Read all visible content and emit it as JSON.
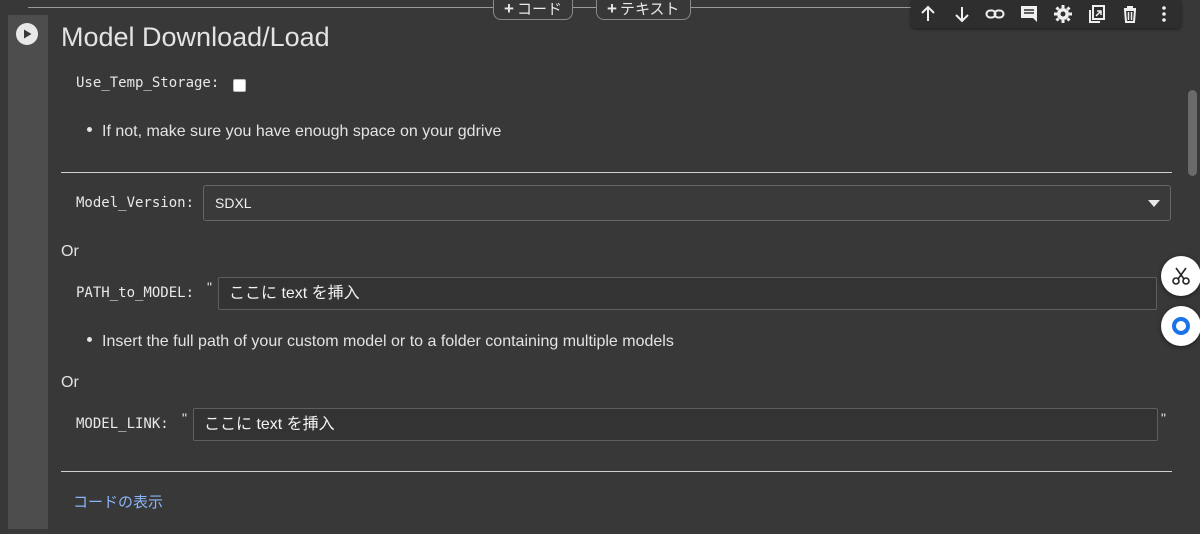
{
  "toolbar": {
    "add_code_label": "コード",
    "add_text_label": "テキスト",
    "icons": [
      "arrow-up-icon",
      "arrow-down-icon",
      "link-icon",
      "comment-icon",
      "gear-icon",
      "mirror-cell-icon",
      "trash-icon",
      "more-vert-icon"
    ]
  },
  "cell": {
    "title": "Model Download/Load",
    "use_temp_storage": {
      "label": "Use_Temp_Storage:",
      "checked": false
    },
    "temp_note": "If not, make sure you have enough space on your gdrive",
    "model_version": {
      "label": "Model_Version:",
      "value": "SDXL"
    },
    "or_1": "Or",
    "path_to_model": {
      "label": "PATH_to_MODEL:",
      "quote": "\"",
      "value": "ここに text を挿入"
    },
    "path_note": "Insert the full path of your custom model or to a folder containing multiple models",
    "or_2": "Or",
    "model_link": {
      "label": "MODEL_LINK:",
      "quote_open": "\"",
      "value": "ここに text を挿入",
      "quote_close": "\""
    },
    "show_code": "コードの表示"
  },
  "colors": {
    "background": "#383838",
    "gutter": "#4d4d4d",
    "link": "#8ab4f8",
    "text": "#e3e3e3"
  },
  "floating": [
    "scissors-icon",
    "chat-bubble-icon"
  ]
}
